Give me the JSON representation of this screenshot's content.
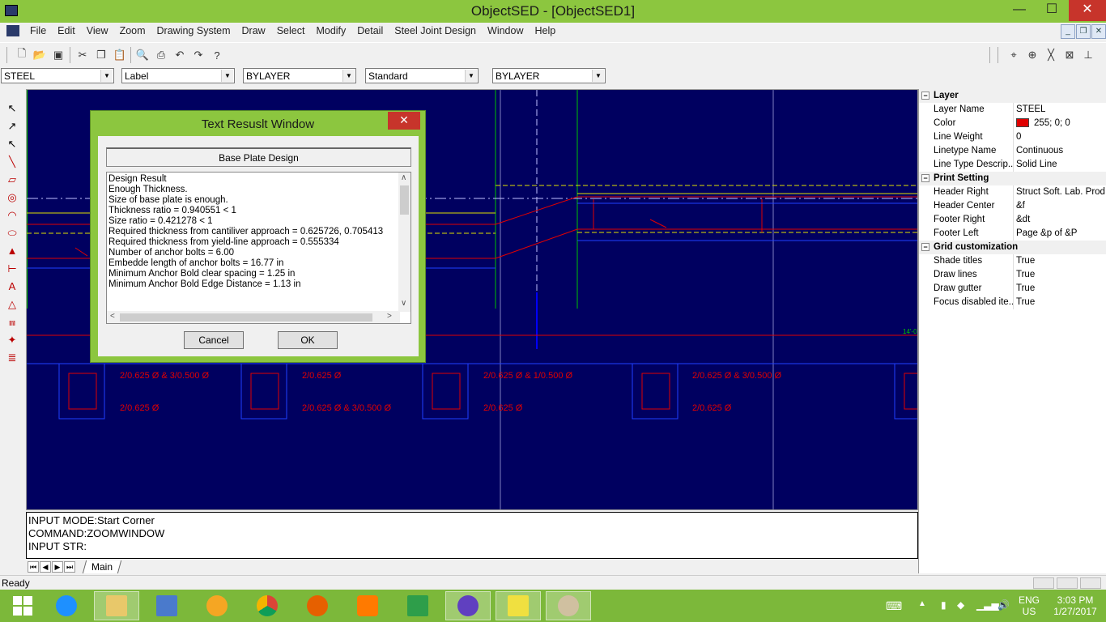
{
  "window": {
    "title": "ObjectSED - [ObjectSED1]",
    "min_glyph": "—",
    "max_glyph": "☐",
    "close_glyph": "✕"
  },
  "menu": {
    "items": [
      "File",
      "Edit",
      "View",
      "Zoom",
      "Drawing System",
      "Draw",
      "Select",
      "Modify",
      "Detail",
      "Steel Joint Design",
      "Window",
      "Help"
    ]
  },
  "combos": {
    "layer": "STEEL",
    "style": "Label",
    "color": "BYLAYER",
    "textstyle": "Standard",
    "linetype": "BYLAYER"
  },
  "properties": {
    "sections": [
      {
        "title": "Layer",
        "rows": [
          {
            "key": "Layer Name",
            "value": "STEEL"
          },
          {
            "key": "Color",
            "value": "255; 0; 0"
          },
          {
            "key": "Line Weight",
            "value": "0"
          },
          {
            "key": "Linetype Name",
            "value": "Continuous"
          },
          {
            "key": "Line Type Descrip...",
            "value": "Solid Line"
          }
        ]
      },
      {
        "title": "Print Setting",
        "rows": [
          {
            "key": "Header Right",
            "value": "Struct Soft. Lab. Prod..."
          },
          {
            "key": "Header Center",
            "value": "&f"
          },
          {
            "key": "Footer Right",
            "value": "&dt"
          },
          {
            "key": "Footer Left",
            "value": "Page &p of &P"
          }
        ]
      },
      {
        "title": "Grid customization",
        "rows": [
          {
            "key": "Shade titles",
            "value": "True"
          },
          {
            "key": "Draw lines",
            "value": "True"
          },
          {
            "key": "Draw gutter",
            "value": "True"
          },
          {
            "key": "Focus disabled ite...",
            "value": "True"
          }
        ]
      }
    ],
    "color_swatch": "#e00000"
  },
  "command": {
    "line1": "INPUT MODE:Start Corner",
    "line2": "COMMAND:ZOOMWINDOW",
    "line3": "INPUT STR:"
  },
  "tabs": {
    "main": "Main"
  },
  "status": {
    "text": "Ready"
  },
  "tray": {
    "lang1": "ENG",
    "lang2": "US",
    "time": "3:03 PM",
    "date": "1/27/2017"
  },
  "dialog": {
    "title": "Text Resuslt Window",
    "close_glyph": "✕",
    "header": "Base Plate Design",
    "lines": [
      "Design Result",
      "Enough Thickness.",
      "Size of base plate is enough.",
      "Thickness ratio =  0.940551 < 1",
      "Size ratio =  0.421278 < 1",
      "Required thickness from cantiliver approach =  0.625726, 0.705413",
      "Required thickness from yield-line approach =  0.555334",
      "Number of anchor bolts =  6.00",
      "Embedde length of anchor bolts = 16.77 in",
      "Minimum Anchor Bold clear spacing =  1.25 in",
      "Minimum Anchor Bold Edge Distance =  1.13 in"
    ],
    "cancel_label": "Cancel",
    "ok_label": "OK"
  },
  "drawing": {
    "section_labels": [
      "2/0.625 Ø & 3/0.500 Ø",
      "2/0.625 Ø",
      "2/0.625 Ø",
      "2/0.625 Ø & 3/0.500 Ø",
      "2/0.625 Ø & 1/0.500 Ø",
      "2/0.625 Ø",
      "2/0.625 Ø & 3/0.500 Ø",
      "2/0.625 Ø"
    ],
    "dim_label": "14'-0"
  },
  "colors": {
    "accent": "#8cc63f",
    "canvas": "#000060",
    "close": "#c7342b"
  }
}
